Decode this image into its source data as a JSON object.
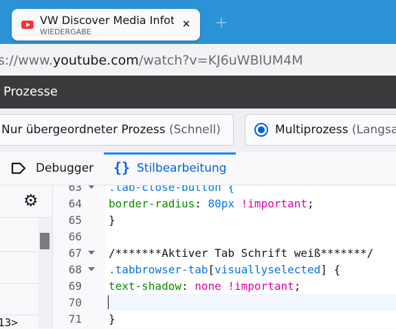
{
  "browser": {
    "tab": {
      "title": "VW Discover Media Infotainment",
      "subtitle": "WIEDERGABE"
    },
    "url": {
      "prefix": "s://www.",
      "host": "youtube.com",
      "path": "/watch?v=KJ6uWBlUM4M"
    }
  },
  "devtools": {
    "header_title": "Prozesse",
    "modes": [
      {
        "label": "Nur übergeordneter Prozess",
        "hint": "(Schnell)",
        "selected": false
      },
      {
        "label": "Multiprozess",
        "hint": "(Langsa",
        "selected": true
      }
    ],
    "tools": [
      {
        "label": "Debugger",
        "active": false
      },
      {
        "label": "Stilbearbeitung",
        "active": true
      }
    ],
    "left_pane": {
      "bottom_text": "13>"
    },
    "editor": {
      "lines": [
        {
          "n": "63",
          "text": ".tab-close-button {"
        },
        {
          "n": "64",
          "text": "border-radius: 80px !important;"
        },
        {
          "n": "65",
          "text": "}"
        },
        {
          "n": "66",
          "text": ""
        },
        {
          "n": "67",
          "text": "/*******Aktiver Tab Schrift weiß*******/"
        },
        {
          "n": "68",
          "text": ".tabbrowser-tab[visuallyselected] {"
        },
        {
          "n": "69",
          "text": "text-shadow: none !important;"
        },
        {
          "n": "70",
          "text": ""
        },
        {
          "n": "71",
          "text": "}"
        }
      ],
      "code_parts": {
        "l63": ".tab-close-button {",
        "l64_prop": "border-radius",
        "l64_colon": ": ",
        "l64_num": "80px",
        "l64_imp": " !important",
        "l64_end": ";",
        "l65": "}",
        "l67": "/*******Aktiver Tab Schrift weiß*******/",
        "l68_sel": ".tabbrowser-tab",
        "l68_open": "[",
        "l68_attr": "visuallyselected",
        "l68_close": "] {",
        "l69_prop": "text-shadow",
        "l69_colon": ": ",
        "l69_val": "none !important",
        "l69_end": ";",
        "l71": "}"
      }
    }
  },
  "colors": {
    "accent": "#0061e0",
    "tabstrip": "#2b92d6",
    "header": "#3a3a3d"
  }
}
